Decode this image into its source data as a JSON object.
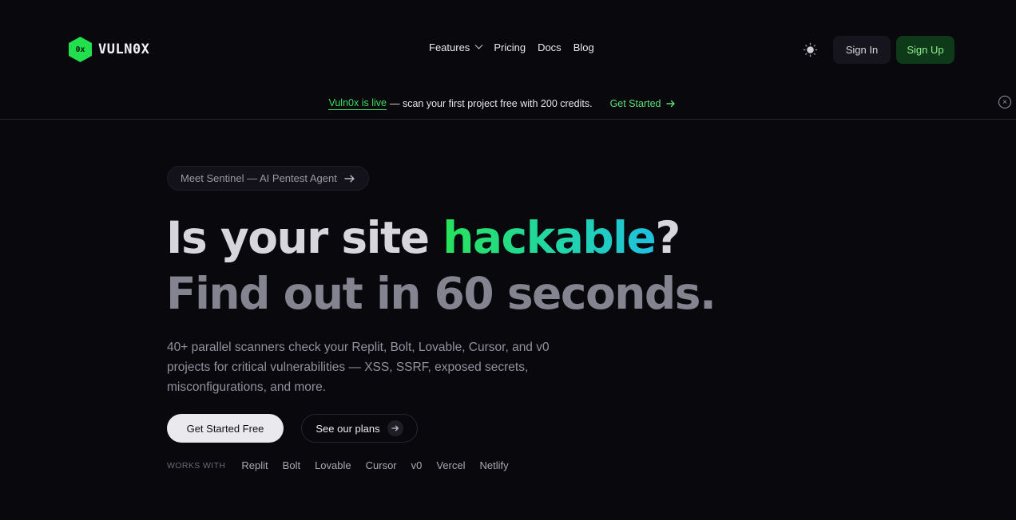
{
  "brand": {
    "name": "VULN0X",
    "logo_text": "0x",
    "accent": "#22e04d"
  },
  "nav": {
    "features": "Features",
    "pricing": "Pricing",
    "docs": "Docs",
    "blog": "Blog"
  },
  "header": {
    "theme_icon": "sun-icon",
    "sign_in": "Sign In",
    "sign_up": "Sign Up"
  },
  "banner": {
    "live": "Vuln0x is live",
    "message": "— scan your first project free with 200 credits.",
    "cta": "Get Started",
    "close_icon": "close-circle-icon"
  },
  "hero": {
    "pill": "Meet Sentinel — AI Pentest Agent",
    "title_part1": "Is your site ",
    "title_highlight": "hackable",
    "title_part2": "?",
    "title_line2": "Find out in 60 seconds.",
    "description": "40+ parallel scanners check your Replit, Bolt, Lovable, Cursor, and v0 projects for critical vulnerabilities — XSS, SSRF, exposed secrets, misconfigurations, and more.",
    "primary_cta": "Get Started Free",
    "secondary_cta": "See our plans"
  },
  "works_with": {
    "label": "WORKS WITH",
    "items": [
      "Replit",
      "Bolt",
      "Lovable",
      "Cursor",
      "v0",
      "Vercel",
      "Netlify"
    ]
  },
  "colors": {
    "background": "#09080c",
    "highlight_gradient_start": "#27e25a",
    "highlight_gradient_end": "#1fc0e0",
    "signup_bg": "#0e3a1a"
  }
}
